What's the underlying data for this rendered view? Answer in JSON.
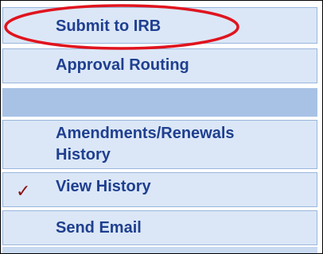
{
  "menu": {
    "items": [
      {
        "label": "Submit to IRB",
        "highlighted": true
      },
      {
        "label": "Approval Routing"
      },
      {
        "label": ""
      },
      {
        "label_line1": "Amendments/Renewals",
        "label_line2": "History"
      },
      {
        "label": "View History",
        "checked": true,
        "check_glyph": "✓"
      },
      {
        "label": "Send Email"
      }
    ]
  },
  "colors": {
    "item_bg": "#dbe7f7",
    "separator_bg": "#a8c2e6",
    "text": "#1f3f8f",
    "highlight_ellipse": "#e0141e",
    "check": "#8b1010"
  }
}
